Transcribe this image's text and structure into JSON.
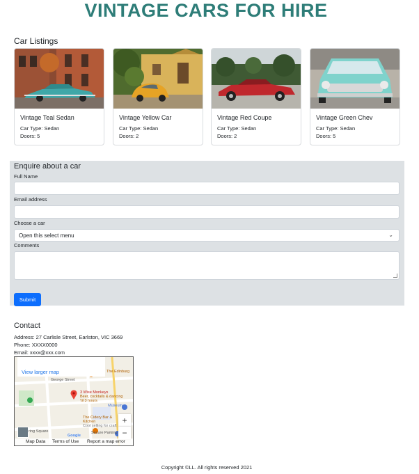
{
  "site": {
    "title": "VINTAGE CARS FOR HIRE"
  },
  "listings": {
    "heading": "Car Listings",
    "cards": [
      {
        "title": "Vintage Teal Sedan",
        "type": "Car Type: Sedan",
        "doors": "Doors: 5",
        "car_color": "#3fa7a8",
        "sky": "#7a3b2a"
      },
      {
        "title": "Vintage Yellow Car",
        "type": "Car Type: Sedan",
        "doors": "Doors: 2",
        "car_color": "#e6a325",
        "sky": "#c7a35a"
      },
      {
        "title": "Vintage Red Coupe",
        "type": "Car Type: Sedan",
        "doors": "Doors: 2",
        "car_color": "#c0282d",
        "sky": "#cfd6d8"
      },
      {
        "title": "Vintage Green Chev",
        "type": "Car Type: Sedan",
        "doors": "Doors: 5",
        "car_color": "#7fd3cc",
        "sky": "#b8b2a8"
      }
    ]
  },
  "enquiry": {
    "heading": "Enquire about a car",
    "full_name_label": "Full Name",
    "email_label": "Email address",
    "car_label": "Choose a car",
    "car_select_value": "Open this select menu",
    "comments_label": "Comments",
    "submit_label": "Submit"
  },
  "contact": {
    "heading": "Contact",
    "address": "Address: 27 Carlisle Street, Earlston, VIC 3669",
    "phone": "Phone: XXXX0000",
    "email": "Email: xxxx@xxx.com"
  },
  "map": {
    "larger_map_link": "View larger map",
    "place_1": "The Edinburg",
    "street_1": "George Street",
    "pin_name": "3 Wise Monkeys",
    "pin_sub": "Beer, cocktails & dancing 'til 3 hours",
    "museum": "Museum",
    "place_2": "The Cidery Bar & Kitchen",
    "place_2_sub": "Cool selling for craft",
    "parking_1": "ring Square",
    "parking_2": "Secure Parking",
    "zoom_in": "+",
    "zoom_out": "−",
    "google": "Google",
    "footer_data": "Map Data",
    "footer_terms": "Terms of Use",
    "footer_report": "Report a map error"
  },
  "footer": {
    "copyright": "Copyright ©LL. All rights reserved 2021"
  }
}
